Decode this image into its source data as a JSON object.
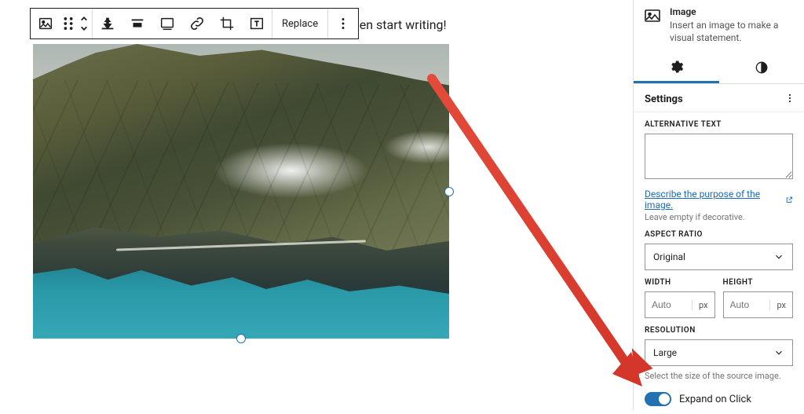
{
  "editor": {
    "placeholder_tail": "e it, then start writing!"
  },
  "toolbar": {
    "replace_label": "Replace"
  },
  "sidebar": {
    "block": {
      "title": "Image",
      "desc": "Insert an image to make a visual statement."
    },
    "panel": {
      "title": "Settings"
    },
    "alt": {
      "label": "ALTERNATIVE TEXT",
      "value": "",
      "link_text": "Describe the purpose of the image.",
      "hint": "Leave empty if decorative."
    },
    "aspect": {
      "label": "ASPECT RATIO",
      "value": "Original"
    },
    "width": {
      "label": "WIDTH",
      "placeholder": "Auto",
      "unit": "px"
    },
    "height": {
      "label": "HEIGHT",
      "placeholder": "Auto",
      "unit": "px"
    },
    "resolution": {
      "label": "RESOLUTION",
      "value": "Large",
      "hint": "Select the size of the source image."
    },
    "expand": {
      "label": "Expand on Click"
    }
  }
}
